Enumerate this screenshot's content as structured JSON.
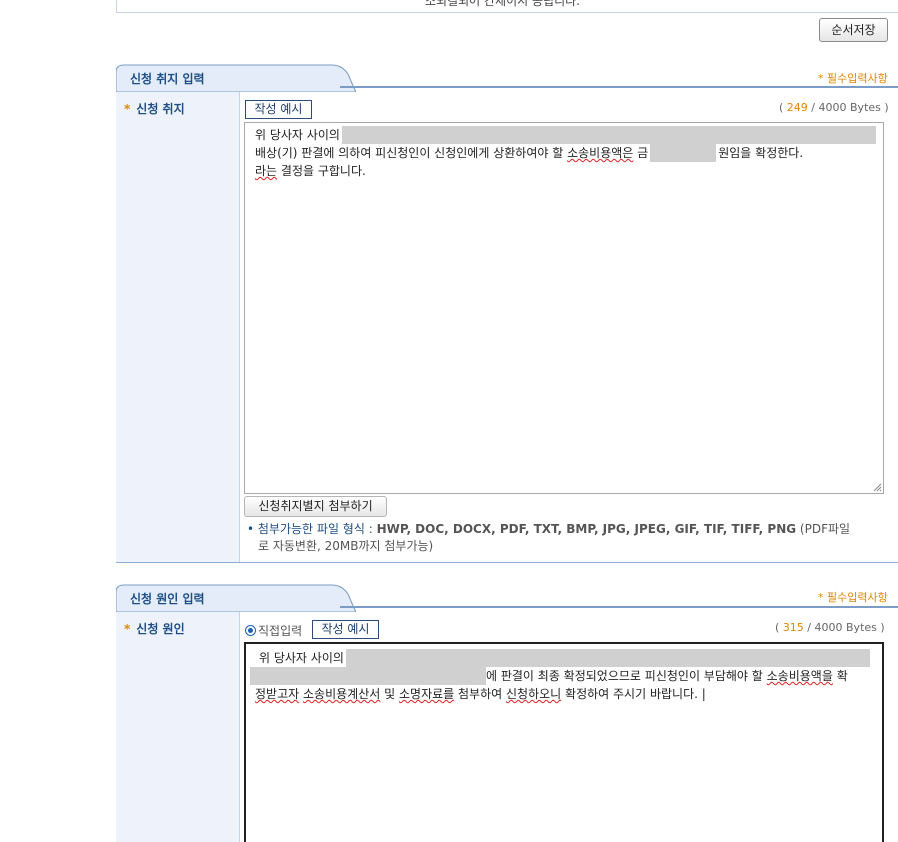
{
  "top_remnant_text": "소되길되어 간세이시 공립니다.",
  "save_order_button": "순서저장",
  "section1": {
    "title": "신청 취지 입력",
    "required_note": "* 필수입력사항",
    "field_label": "신청 취지",
    "star": "*",
    "example_button": "작성 예시",
    "counter": {
      "open": "(",
      "count": "249",
      "sep": "/",
      "max": "4000 Bytes",
      "close": ")"
    },
    "text": {
      "l1_prefix": "위 당사자 사이의",
      "l2_a": "배상(기) 판결에 의하여 피신청인이 신청인에게 상환하여야 할",
      "l2_sq": "소송비용액은",
      "l2_b": "금",
      "l2_c": "원임을 확정한다.",
      "l3_sq": "라는",
      "l3_b": "결정을 구합니다."
    },
    "attach_button": "신청취지별지 첨부하기",
    "file_note_label": "• 첨부가능한 파일 형식 :",
    "file_note_types": "HWP, DOC, DOCX, PDF, TXT, BMP, JPG, JPEG, GIF, TIF, TIFF, PNG",
    "file_note_tail1": "(PDF파일",
    "file_note_tail2": "로 자동변환, 20MB까지 첨부가능)"
  },
  "section2": {
    "title": "신청 원인 입력",
    "required_note": "* 필수입력사항",
    "field_label": "신청 원인",
    "star": "*",
    "radio_label": "직접입력",
    "example_button": "작성 예시",
    "counter": {
      "open": "(",
      "count": "315",
      "sep": "/",
      "max": "4000 Bytes",
      "close": ")"
    },
    "text": {
      "l1_prefix": "위 당사자 사이의",
      "l2_a": "에 판결이 최종 확정되었으므로 피신청인이 부담해야 할",
      "l2_sq": "소송비용액을",
      "l2_b": "확",
      "l3_sq1": "정받고자",
      "l3_sq2": "소송비용계산서",
      "l3_a": "및",
      "l3_sq3": "소명자료를",
      "l3_b": "첨부하여",
      "l3_sq4": "신청하오니",
      "l3_c": "확정하여 주시기 바랍니다. |"
    }
  },
  "colors": {
    "accent": "#1f4e85",
    "required": "#e08600",
    "label_bg": "#eef3fb"
  }
}
